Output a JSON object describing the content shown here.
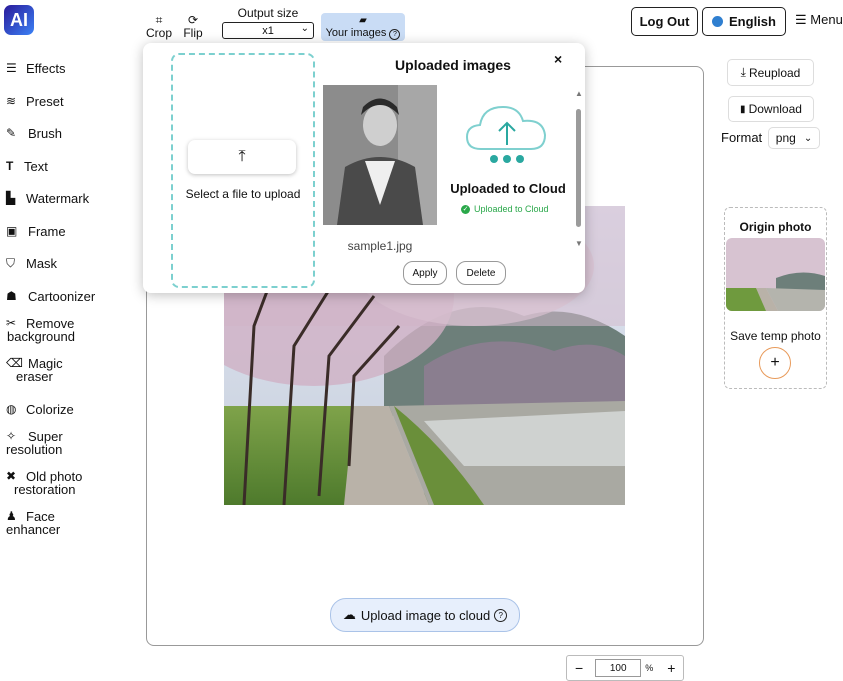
{
  "app": {
    "logo_text": "AI"
  },
  "toolbar": {
    "crop_label": "Crop",
    "flip_label": "Flip",
    "output_size_label": "Output size",
    "output_size_value": "x1",
    "your_images_label": "Your images",
    "logout_label": "Log Out",
    "language_label": "English",
    "menu_label": "Menu"
  },
  "sidebar": {
    "items": [
      {
        "label": "Effects",
        "icon": "menu-lines-icon"
      },
      {
        "label": "Preset",
        "icon": "sliders-icon"
      },
      {
        "label": "Brush",
        "icon": "brush-icon"
      },
      {
        "label": "Text",
        "icon": "text-icon"
      },
      {
        "label": "Watermark",
        "icon": "stamp-icon"
      },
      {
        "label": "Frame",
        "icon": "image-frame-icon"
      },
      {
        "label": "Mask",
        "icon": "shield-icon"
      },
      {
        "label": "Cartoonizer",
        "icon": "cartoon-icon"
      },
      {
        "label": "Remove background",
        "line1": "Remove",
        "line2": "background",
        "icon": "scissors-icon"
      },
      {
        "label": "Magic eraser",
        "line1": "Magic",
        "line2": "eraser",
        "icon": "eraser-icon"
      },
      {
        "label": "Colorize",
        "icon": "palette-icon"
      },
      {
        "label": "Super resolution",
        "line1": "Super",
        "line2": "resolution",
        "icon": "wand-icon"
      },
      {
        "label": "Old photo restoration",
        "line1": "Old photo",
        "line2": "restoration",
        "icon": "tools-icon"
      },
      {
        "label": "Face enhancer",
        "line1": "Face",
        "line2": "enhancer",
        "icon": "user-icon"
      }
    ]
  },
  "right_panel": {
    "reupload_label": "Reupload",
    "download_label": "Download",
    "format_label": "Format",
    "format_value": "png",
    "origin_title": "Origin photo",
    "save_temp_label": "Save temp photo"
  },
  "canvas": {
    "upload_cloud_label": "Upload image to cloud",
    "zoom_value": "100",
    "zoom_unit": "%"
  },
  "modal": {
    "title": "Uploaded images",
    "select_file_label": "Select a file to upload",
    "image_name": "sample1.jpg",
    "cloud_title": "Uploaded to Cloud",
    "cloud_status": "Uploaded to Cloud",
    "apply_label": "Apply",
    "delete_label": "Delete"
  },
  "colors": {
    "accent": "#2aa8a0",
    "highlight": "#c9dcf5"
  }
}
